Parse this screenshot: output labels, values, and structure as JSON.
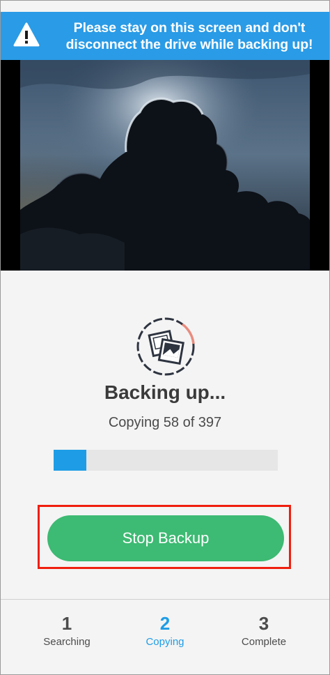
{
  "banner": {
    "icon": "warning-icon",
    "line1": "Please stay on this screen and don't",
    "line2": "disconnect the drive while backing up!",
    "color": "#2a9be6"
  },
  "photo": {
    "icon": "cloud-photo"
  },
  "progress": {
    "icon": "photos-progress-icon",
    "title": "Backing up...",
    "status": "Copying 58 of 397",
    "copied": 58,
    "total": 397,
    "fill_fraction": 0.146,
    "bar_color": "#1e9de6"
  },
  "actions": {
    "stop_label": "Stop Backup",
    "stop_color": "#3dba73",
    "highlight_color": "#f01e0e"
  },
  "steps": [
    {
      "number": "1",
      "label": "Searching",
      "active": false
    },
    {
      "number": "2",
      "label": "Copying",
      "active": true
    },
    {
      "number": "3",
      "label": "Complete",
      "active": false
    }
  ],
  "colors": {
    "active_step": "#1e9de6",
    "inactive_step": "#4c4c4c"
  }
}
